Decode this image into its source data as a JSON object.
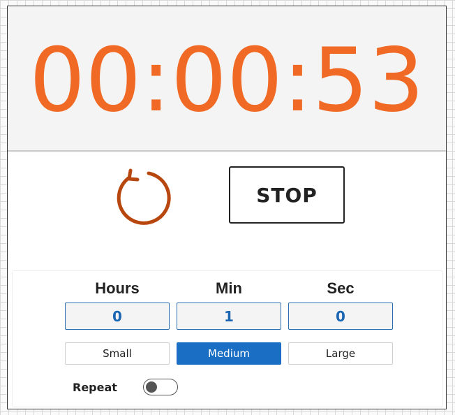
{
  "timer": {
    "display": "00:00:53"
  },
  "controls": {
    "reset_icon": "reset-icon",
    "stop_label": "STOP"
  },
  "settings": {
    "hours_label": "Hours",
    "min_label": "Min",
    "sec_label": "Sec",
    "hours_value": "0",
    "min_value": "1",
    "sec_value": "0",
    "sizes": [
      "Small",
      "Medium",
      "Large"
    ],
    "selected_size": "Medium",
    "repeat_label": "Repeat",
    "repeat_on": false
  },
  "colors": {
    "timer_text": "#f06a25",
    "reset_icon": "#b8470f",
    "accent": "#1a6fc4",
    "input_text": "#1a66b3"
  }
}
